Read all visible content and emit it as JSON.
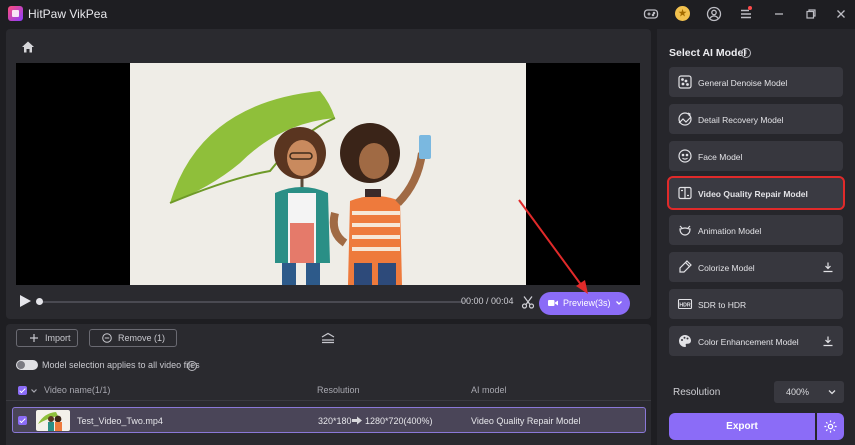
{
  "app": {
    "title": "HitPaw VikPea"
  },
  "player": {
    "time": "00:00 / 00:04",
    "preview_label": "Preview(3s)"
  },
  "toolbar": {
    "import_label": "Import",
    "remove_label": "Remove (1)"
  },
  "list": {
    "toggle_label": "Model selection applies to all video files",
    "columns": {
      "name": "Video name(1/1)",
      "resolution": "Resolution",
      "model": "AI model"
    },
    "rows": [
      {
        "name": "Test_Video_Two.mp4",
        "res_from": "320*180",
        "res_to": "1280*720(400%)",
        "model": "Video Quality Repair Model"
      }
    ]
  },
  "sidebar": {
    "title": "Select AI Model",
    "models": [
      {
        "label": "General Denoise Model",
        "icon": "denoise-icon",
        "download": false
      },
      {
        "label": "Detail Recovery Model",
        "icon": "detail-recovery-icon",
        "download": false
      },
      {
        "label": "Face Model",
        "icon": "face-icon",
        "download": false
      },
      {
        "label": "Video Quality Repair Model",
        "icon": "video-repair-icon",
        "download": false,
        "selected": true
      },
      {
        "label": "Animation Model",
        "icon": "animation-icon",
        "download": false
      },
      {
        "label": "Colorize Model",
        "icon": "colorize-icon",
        "download": true
      },
      {
        "label": "SDR to HDR",
        "icon": "hdr-icon",
        "download": false
      },
      {
        "label": "Color Enhancement Model",
        "icon": "palette-icon",
        "download": true
      }
    ],
    "resolution_label": "Resolution",
    "resolution_value": "400%",
    "export_label": "Export"
  },
  "colors": {
    "accent": "#8b6cf7",
    "highlight_box": "#e02a2a",
    "annotation_arrow": "#e02a2a"
  }
}
